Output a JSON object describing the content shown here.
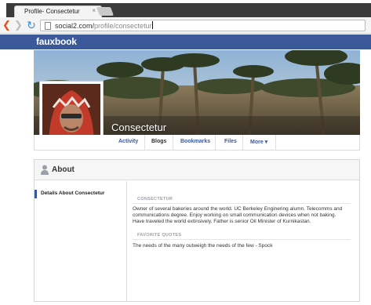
{
  "browser": {
    "tab_title": "Profile- Consectetur",
    "tab_close": "×",
    "url_host": "social2.com/",
    "url_path": "profile/consectetur"
  },
  "site": {
    "logo": "fauxbook"
  },
  "profile": {
    "name": "Consectetur",
    "nav": [
      "Activity",
      "Blogs",
      "Bookmarks",
      "Files",
      "More ▾"
    ],
    "active_nav": "Blogs"
  },
  "about": {
    "title": "About",
    "sidebar_item": "Details About Consectetur",
    "section1_heading": "CONSECTETUR",
    "section1_text": "Owner of several bakeries around the world. UC Berkeley Enginering alumn. Telecomms and communications degree. Enjoy working on small communication devices when not baking. Have traveled the world extinsively. Father is senior Oil Minister of Kurnikastan.",
    "section2_heading": "FAVORITE QUOTES",
    "section2_text": "The needs of the many outweigh the needs of the few - Spock"
  },
  "colors": {
    "brand": "#3b5998",
    "link": "#3b5998"
  },
  "icons": [
    "close-icon",
    "back-arrow-icon",
    "forward-arrow-icon",
    "reload-icon",
    "page-icon",
    "person-icon"
  ]
}
